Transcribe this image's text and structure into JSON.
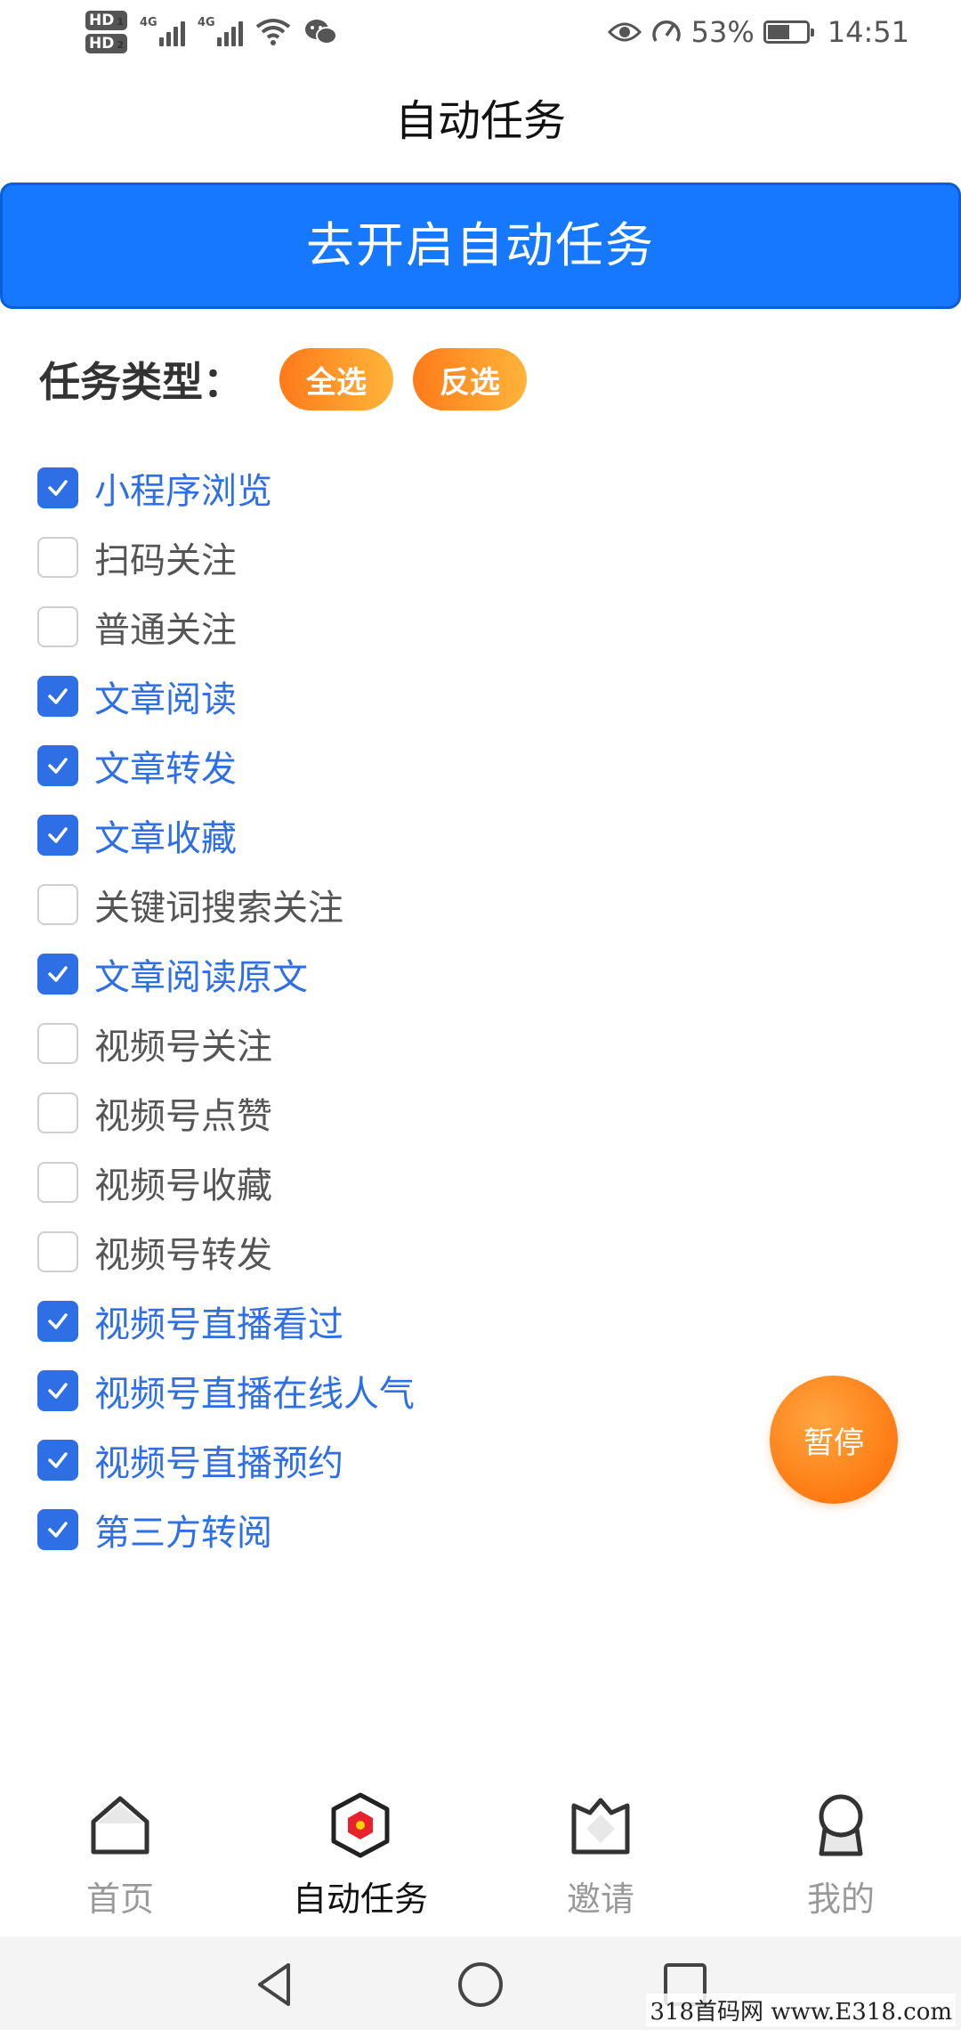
{
  "status_bar": {
    "hd1": "HD",
    "hd1_sub": "1",
    "hd2": "HD",
    "hd2_sub": "2",
    "network1": "4G",
    "network2": "4G",
    "battery_percent": "53%",
    "time": "14:51",
    "icons": [
      "eye-icon",
      "speed-icon",
      "wifi-icon",
      "wechat-icon"
    ]
  },
  "title": "自动任务",
  "start_button": "去开启自动任务",
  "task_type": {
    "label": "任务类型：",
    "select_all": "全选",
    "invert": "反选"
  },
  "tasks": [
    {
      "label": "小程序浏览",
      "checked": true
    },
    {
      "label": "扫码关注",
      "checked": false
    },
    {
      "label": "普通关注",
      "checked": false
    },
    {
      "label": "文章阅读",
      "checked": true
    },
    {
      "label": "文章转发",
      "checked": true
    },
    {
      "label": "文章收藏",
      "checked": true
    },
    {
      "label": "关键词搜索关注",
      "checked": false
    },
    {
      "label": "文章阅读原文",
      "checked": true
    },
    {
      "label": "视频号关注",
      "checked": false
    },
    {
      "label": "视频号点赞",
      "checked": false
    },
    {
      "label": "视频号收藏",
      "checked": false
    },
    {
      "label": "视频号转发",
      "checked": false
    },
    {
      "label": "视频号直播看过",
      "checked": true
    },
    {
      "label": "视频号直播在线人气",
      "checked": true
    },
    {
      "label": "视频号直播预约",
      "checked": true
    },
    {
      "label": "第三方转阅",
      "checked": true
    }
  ],
  "pause_button": "暂停",
  "tabs": [
    {
      "label": "首页",
      "icon": "home-icon",
      "active": false
    },
    {
      "label": "自动任务",
      "icon": "auto-task-icon",
      "active": true
    },
    {
      "label": "邀请",
      "icon": "invite-icon",
      "active": false
    },
    {
      "label": "我的",
      "icon": "profile-icon",
      "active": false
    }
  ],
  "colors": {
    "primary": "#1677ff",
    "checked": "#2f6fe6",
    "orange": "#ff8a1f"
  },
  "watermark": "318首码网 www.E318.com"
}
